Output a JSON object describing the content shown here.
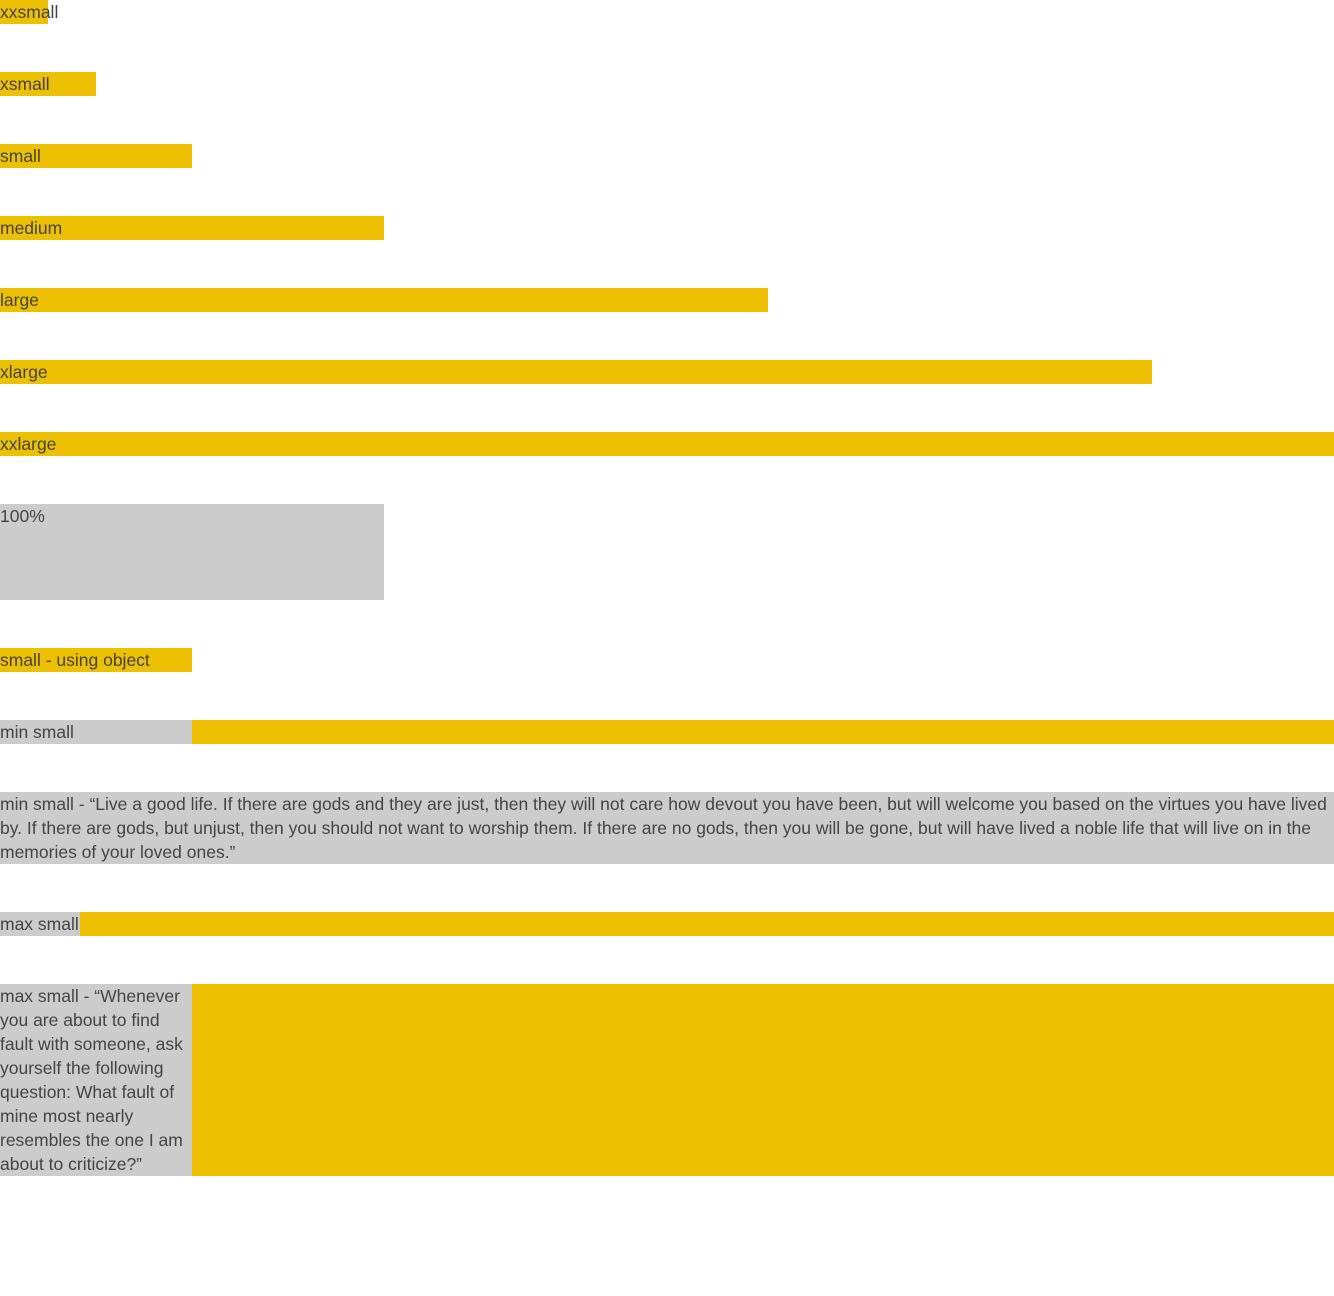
{
  "boxes": {
    "xxsmall": "xxsmall",
    "xsmall": "xsmall",
    "small": "small",
    "medium": "medium",
    "large": "large",
    "xlarge": "xlarge",
    "xxlarge": "xxlarge",
    "percent": "100%",
    "small_object": "small - using object",
    "min_small": "min small",
    "min_small_quote": "min small - “Live a good life. If there are gods and they are just, then they will not care how devout you have been, but will welcome you based on the virtues you have lived by. If there are gods, but unjust, then you should not want to worship them. If there are no gods, then you will be gone, but will have lived a noble life that will live on in the memories of your loved ones.”",
    "max_small": "max small",
    "max_small_quote": "max small - “Whenever you are about to find fault with someone, ask yourself the following question: What fault of mine most nearly resembles the one I am about to criticize?”"
  },
  "colors": {
    "accent": "#edc001",
    "neutral": "#cccccc",
    "text": "#444444"
  }
}
